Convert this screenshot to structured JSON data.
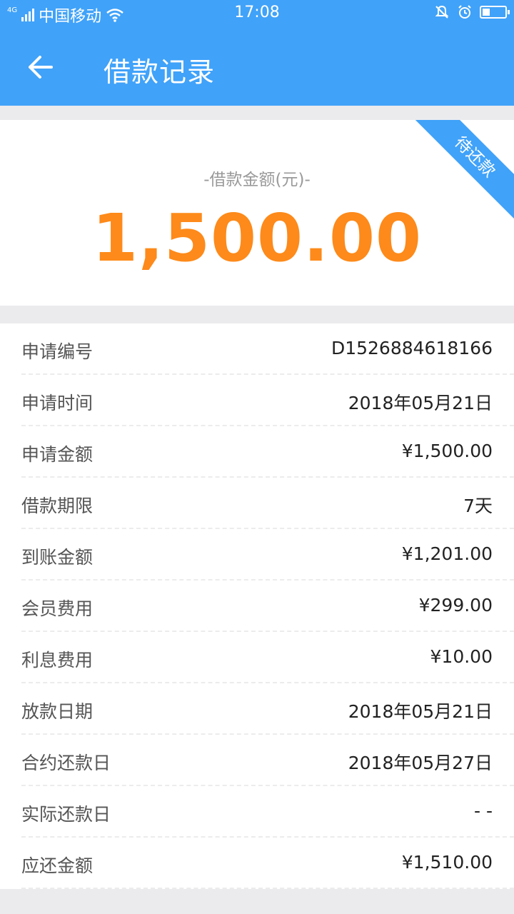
{
  "status_bar": {
    "network_tag": "4G",
    "carrier": "中国移动",
    "time": "17:08",
    "icons": [
      "signal-icon",
      "wifi-icon",
      "mute-icon",
      "alarm-icon",
      "battery-icon"
    ]
  },
  "header": {
    "title": "借款记录",
    "back_icon": "arrow-left-icon"
  },
  "loan": {
    "amount_label": "-借款金额(元)-",
    "amount": "1,500.00",
    "status_ribbon": "待还款"
  },
  "colors": {
    "accent_blue": "#40a2f9",
    "amount_orange": "#fd8a1a",
    "page_bg": "#ebebee"
  },
  "details": [
    {
      "label": "申请编号",
      "value": "D1526884618166"
    },
    {
      "label": "申请时间",
      "value": "2018年05月21日"
    },
    {
      "label": "申请金额",
      "value": "¥1,500.00"
    },
    {
      "label": "借款期限",
      "value": "7天"
    },
    {
      "label": "到账金额",
      "value": "¥1,201.00"
    },
    {
      "label": "会员费用",
      "value": "¥299.00"
    },
    {
      "label": "利息费用",
      "value": "¥10.00"
    },
    {
      "label": "放款日期",
      "value": "2018年05月21日"
    },
    {
      "label": "合约还款日",
      "value": "2018年05月27日"
    },
    {
      "label": "实际还款日",
      "value": "- -"
    },
    {
      "label": "应还金额",
      "value": "¥1,510.00"
    }
  ]
}
